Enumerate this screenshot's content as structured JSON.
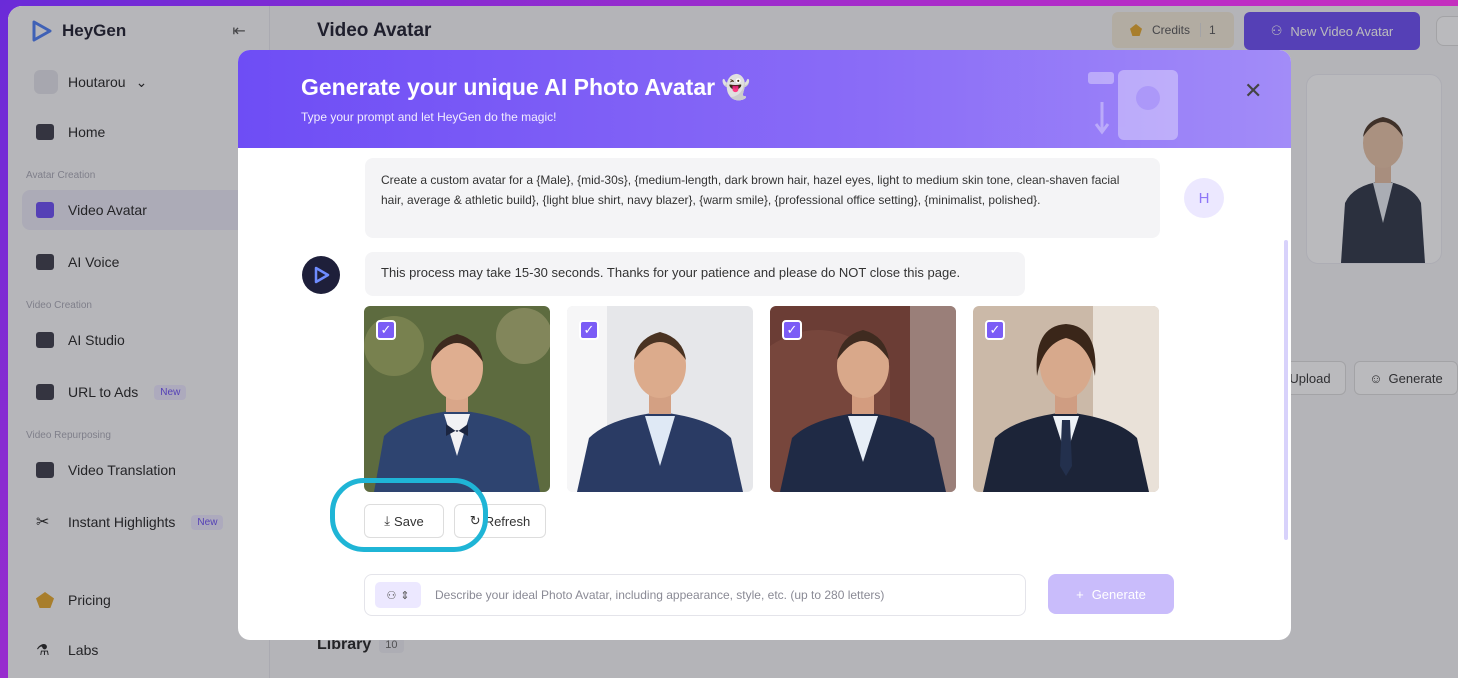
{
  "app": {
    "name": "HeyGen",
    "workspace": "Houtarou"
  },
  "sidebar": {
    "items": [
      {
        "label": "Home"
      },
      {
        "label": "Video Avatar"
      },
      {
        "label": "AI Voice"
      },
      {
        "label": "AI Studio"
      },
      {
        "label": "URL to Ads",
        "badge": "New"
      },
      {
        "label": "Video Translation"
      },
      {
        "label": "Instant Highlights",
        "badge": "New"
      },
      {
        "label": "Pricing"
      },
      {
        "label": "Labs"
      }
    ],
    "sections": [
      "Avatar Creation",
      "Video Creation",
      "Video Repurposing"
    ]
  },
  "header": {
    "title": "Video Avatar",
    "credits_label": "Credits",
    "credits_count": "1",
    "new_avatar_label": "New Video Avatar"
  },
  "background": {
    "upload_label": "Upload",
    "generate_label": "Generate",
    "library_label": "Library",
    "library_count": "10"
  },
  "modal": {
    "title": "Generate your unique AI Photo Avatar 👻",
    "subtitle": "Type your prompt and let HeyGen do the magic!",
    "user_initial": "H",
    "user_message": "Create a custom avatar for a {Male}, {mid-30s}, {medium-length, dark brown hair, hazel eyes, light to medium skin tone, clean-shaven facial hair, average & athletic build}, {light blue shirt, navy blazer}, {warm smile}, {professional office setting}, {minimalist, polished}.",
    "bot_message": "This process may take 15-30 seconds. Thanks for your patience and please do NOT close this page.",
    "save_label": "Save",
    "refresh_label": "Refresh",
    "prompt_placeholder": "Describe your ideal Photo Avatar, including appearance, style, etc. (up to 280 letters)",
    "generate_label": "Generate"
  },
  "colors": {
    "accent": "#6a4cf5",
    "highlight": "#1fb5d6",
    "header_gradient_start": "#6e4df5"
  }
}
